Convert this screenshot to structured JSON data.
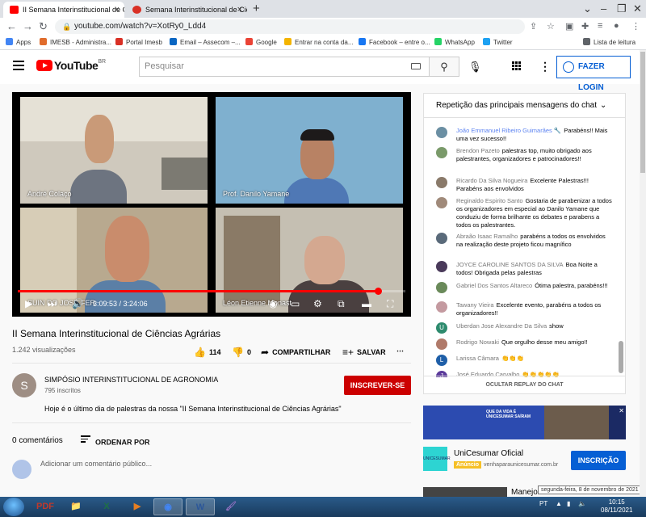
{
  "browser": {
    "tabs": [
      {
        "title": "II Semana Interinstitucional de C"
      },
      {
        "title": "Semana Interinstitucional de Ciên"
      }
    ],
    "url": "youtube.com/watch?v=XotRy0_Ldd4",
    "bookmarks": [
      {
        "label": "Apps",
        "color": "#4285f4"
      },
      {
        "label": "IMESB - Administra...",
        "color": "#e06c2c"
      },
      {
        "label": "Portal Imesb",
        "color": "#d93025"
      },
      {
        "label": "Email – Assecom –...",
        "color": "#0a66c2"
      },
      {
        "label": "Google",
        "color": "#ea4335"
      },
      {
        "label": "Entrar na conta da...",
        "color": "#f4b400"
      },
      {
        "label": "Facebook – entre o...",
        "color": "#1877f2"
      },
      {
        "label": "WhatsApp",
        "color": "#25d366"
      },
      {
        "label": "Twitter",
        "color": "#1da1f2"
      }
    ],
    "reading_list": "Lista de leitura"
  },
  "youtube": {
    "logo": "YouTube",
    "region": "BR",
    "search_placeholder": "Pesquisar",
    "login": "FAZER LOGIN"
  },
  "video": {
    "participants": [
      "André Colaço",
      "Prof. Danilo Yamane",
      "SUIN DO JOSÉ FER",
      "Léon Etienne Monast"
    ],
    "time_current": "3:09:53",
    "time_total": "3:24:06",
    "progress": 0.93,
    "title": "II Semana Interinstitucional de Ciências Agrárias",
    "views": "1.242 visualizações",
    "likes": "114",
    "dislikes": "0",
    "share": "COMPARTILHAR",
    "save": "SALVAR"
  },
  "channel": {
    "initial": "S",
    "name": "SIMPÓSIO INTERINSTITUCIONAL DE AGRONOMIA",
    "subscribers": "795 inscritos",
    "subscribe": "INSCREVER-SE",
    "description": "Hoje é o último dia de palestras da nossa \"II Semana Interinstitucional de Ciências Agrárias\""
  },
  "comments": {
    "count": "0 comentários",
    "order": "ORDENAR POR",
    "placeholder": "Adicionar um comentário público..."
  },
  "chat": {
    "header": "Repetição das principais mensagens do chat",
    "footer": "OCULTAR REPLAY DO CHAT",
    "messages": [
      {
        "author": "João Emmanuel Ribeiro Guimarães 🔧",
        "text": "Parabéns!! Mais uma vez sucesso!!",
        "color": "#6b8fa3",
        "mod": true
      },
      {
        "author": "Brendon Pazeto",
        "text": "palestras top, muito obrigado aos palestrantes, organizadores e patrocinadores!!",
        "color": "#7a9a6a",
        "mod": false
      },
      {
        "author": "Ricardo Da Silva Nogueira",
        "text": "Excelente Palestras!!! Parabéns aos envolvidos",
        "color": "#8a7a6a",
        "mod": false
      },
      {
        "author": "Reginaldo Espirito Santo",
        "text": "Gostaria de parabenizar a todos os organizadores em especial ao Danilo Yamane que conduziu de forma brilhante os debates e parabens a todos os palestrantes.",
        "color": "#a08a7a",
        "mod": false
      },
      {
        "author": "Abraão Isaac Ramalho",
        "text": "parabéns a todos os envolvidos na realização deste projeto ficou magnífico",
        "color": "#5a6a7a",
        "mod": false
      },
      {
        "author": "JOYCE CAROLINE SANTOS DA SILVA",
        "text": "Boa Noite a todos! Obrigada pelas palestras",
        "color": "#4a3a5a",
        "mod": false
      },
      {
        "author": "Gabriel Dos Santos Altareco",
        "text": "Ótima palestra, parabéns!!!",
        "color": "#6a8a5a",
        "mod": false
      },
      {
        "author": "Tawany Vieira",
        "text": "Excelente evento, parabéns a todos os organizadores!!",
        "color": "#c49aa0",
        "mod": false
      },
      {
        "author": "Uberdan Jose Alexandre Da Silva",
        "text": "show",
        "color": "#2e8b6e",
        "mod": false
      },
      {
        "author": "Rodrigo Nowaki",
        "text": "Que orgulho desse meu amigo!!",
        "color": "#b07a6a",
        "mod": false
      },
      {
        "author": "Larissa Câmara",
        "text": "👏👏👏",
        "color": "#1f5fa8",
        "mod": false
      },
      {
        "author": "José Eduardo Carvalho",
        "text": "👏👏👏👏👏",
        "color": "#5b3a9a",
        "mod": false
      }
    ],
    "avatar_letters": {
      "8": "U",
      "10": "L",
      "11": "J"
    }
  },
  "ad": {
    "banner_text": "QUE DA VIDA É UNICESUMAR SAÍRAM",
    "logo_text": "UNICESUMAR",
    "title": "UniCesumar Oficial",
    "badge": "Anúncio",
    "url": "venhaparaunicesumar.com.br",
    "cta": "INSCRIÇÃO"
  },
  "next": {
    "title": "Manejo"
  },
  "tooltip": "segunda-feira, 8 de novembro de 2021",
  "taskbar": {
    "apps": [
      "PDF",
      "📁",
      "X",
      "▶",
      "◉",
      "W",
      "🖌"
    ],
    "lang": "PT",
    "time": "10:15",
    "date": "08/11/2021"
  }
}
